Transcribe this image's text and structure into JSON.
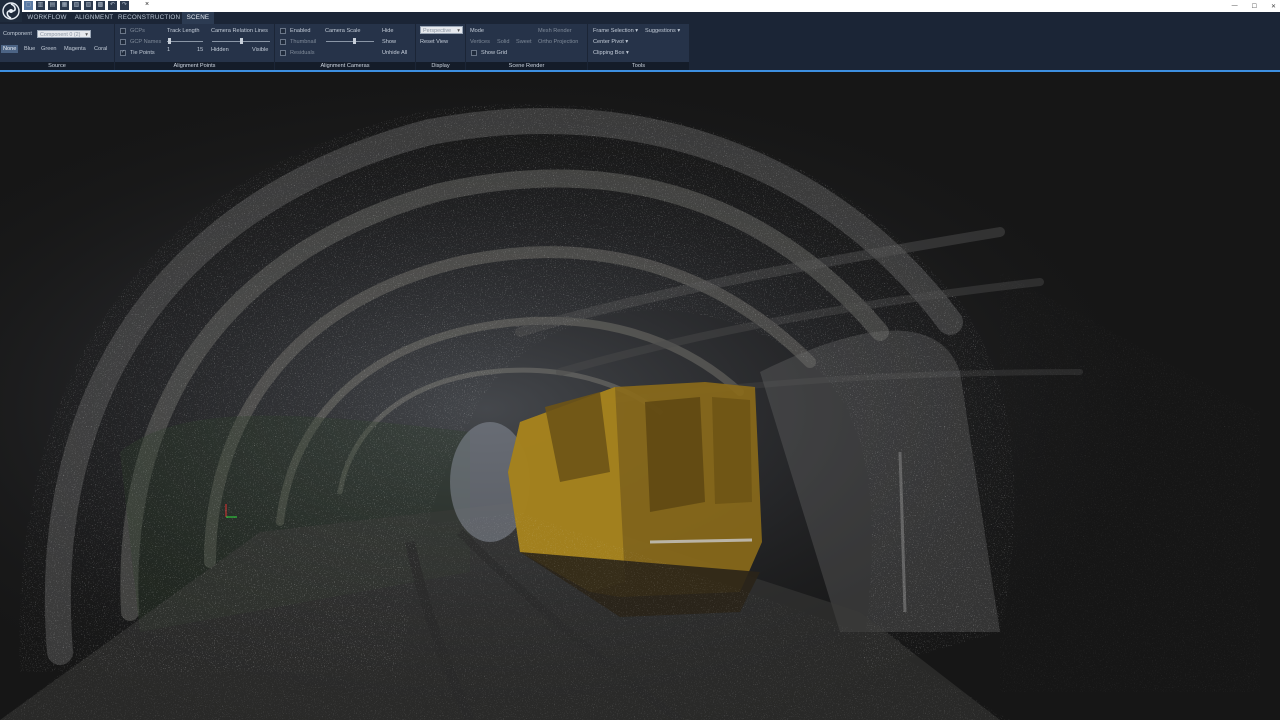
{
  "titlebar": {
    "doc_close": "×",
    "controls": [
      "—",
      "☐",
      "✕"
    ]
  },
  "menu": {
    "tabs": [
      {
        "label": "WORKFLOW"
      },
      {
        "label": "ALIGNMENT"
      },
      {
        "label": "RECONSTRUCTION"
      },
      {
        "label": "SCENE"
      }
    ]
  },
  "ribbon": {
    "source": {
      "label": "Source",
      "component_label": "Component",
      "component_value": "Component 0 (2)",
      "colors": [
        "None",
        "Blue",
        "Green",
        "Magenta",
        "Coral"
      ]
    },
    "alignment_points": {
      "label": "Alignment Points",
      "gcps": "GCPs",
      "gcp_names": "GCP Names",
      "tie_points": "Tie Points",
      "track_length": "Track Length",
      "track_min": "1",
      "track_max": "15",
      "relation_lines": "Camera Relation Lines",
      "hidden": "Hidden",
      "visible": "Visible"
    },
    "alignment_cameras": {
      "label": "Alignment Cameras",
      "enabled": "Enabled",
      "thumbnail": "Thumbnail",
      "residuals": "Residuals",
      "camera_scale": "Camera Scale",
      "hide": "Hide",
      "show": "Show",
      "unhide_all": "Unhide All"
    },
    "display": {
      "label": "Display",
      "projection": "Perspective",
      "reset_view": "Reset View"
    },
    "scene_render": {
      "label": "Scene Render",
      "mode": "Mode",
      "vertices": "Vertices",
      "solid": "Solid",
      "sweet": "Sweet",
      "mesh_render": "Mesh Render",
      "ortho_projection": "Ortho Projection",
      "show_grid": "Show Grid"
    },
    "tools": {
      "label": "Tools",
      "frame_selection": "Frame Selection",
      "suggestions": "Suggestions",
      "center_pivot": "Center Pivot",
      "clipping_box": "Clipping Box"
    }
  },
  "colors": {
    "ribbon_bg": "#263349",
    "accent": "#3d8fe0",
    "viewport_bg": "#161616"
  }
}
